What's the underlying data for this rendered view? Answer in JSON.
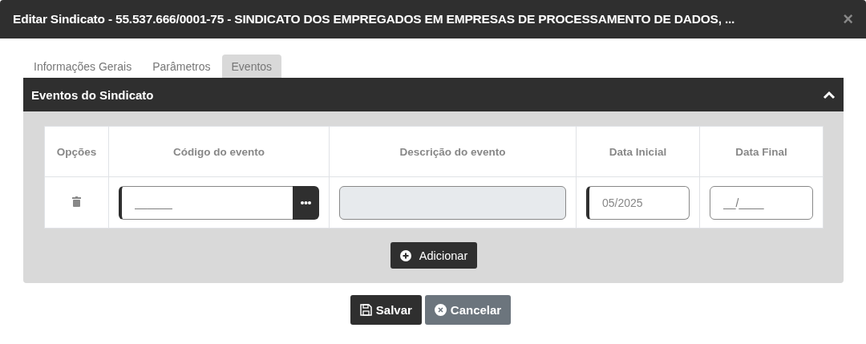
{
  "window": {
    "title": "Editar Sindicato - 55.537.666/0001-75 - SINDICATO DOS EMPREGADOS EM EMPRESAS DE PROCESSAMENTO DE DADOS, ...",
    "close": "×"
  },
  "tabs": [
    {
      "label": "Informações Gerais",
      "selected": false
    },
    {
      "label": "Parâmetros",
      "selected": false
    },
    {
      "label": "Eventos",
      "selected": true
    }
  ],
  "panel": {
    "title": "Eventos do Sindicato",
    "expanded": true,
    "table": {
      "columns": [
        "Opções",
        "Código do evento",
        "Descrição do evento",
        "Data Inicial",
        "Data Final"
      ],
      "rows": [
        {
          "code": {
            "placeholder": "______"
          },
          "description": {
            "disabled": true
          },
          "start": {
            "value": "05/2025"
          },
          "end": {
            "placeholder": "__/____"
          }
        }
      ]
    },
    "add_button": "Adicionar"
  },
  "buttons": [
    {
      "kind": "save",
      "label": "Salvar"
    },
    {
      "kind": "cancel",
      "label": "Cancelar"
    }
  ]
}
